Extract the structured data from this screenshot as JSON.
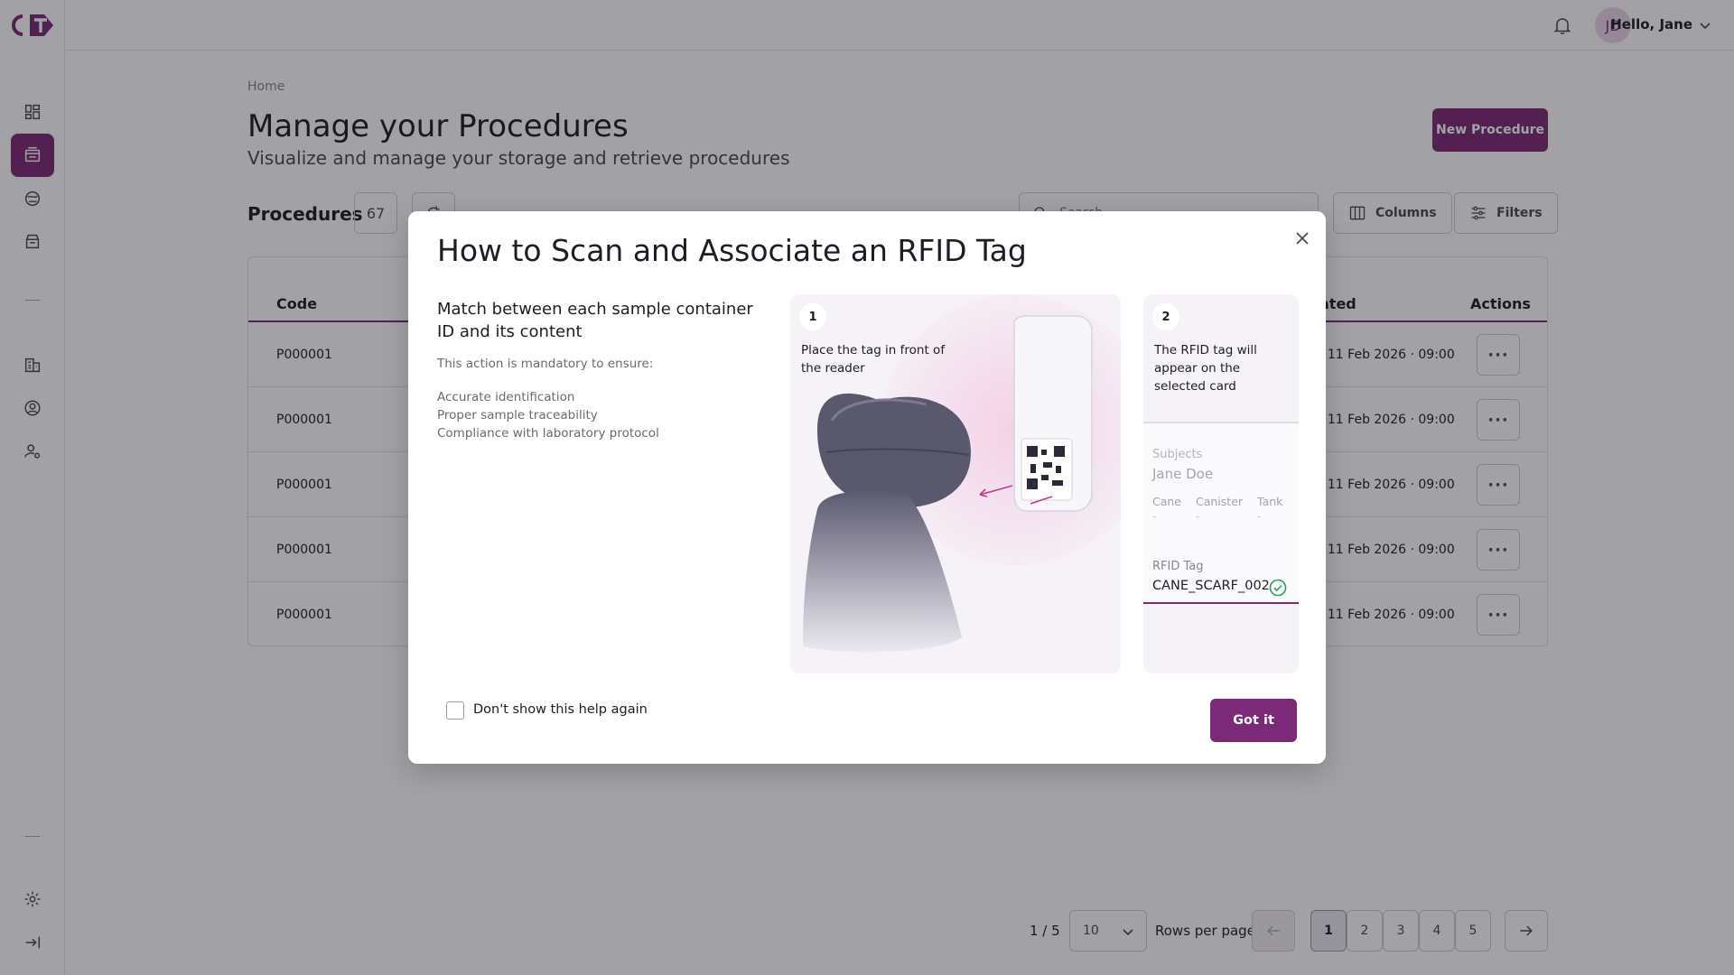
{
  "app": {
    "logo_text": "CT"
  },
  "header": {
    "avatar_initials": "JD",
    "greeting": "Hello, Jane"
  },
  "breadcrumb": "Home",
  "page": {
    "title": "Manage your Procedures",
    "subtitle": "Visualize and manage your storage and retrieve procedures",
    "new_button": "New Procedure"
  },
  "toolbar": {
    "label": "Procedures",
    "count": "67",
    "search_placeholder": "Search",
    "columns_label": "Columns",
    "filters_label": "Filters"
  },
  "table": {
    "columns": {
      "code": "Code",
      "updated": "ated",
      "actions": "Actions"
    },
    "rows": [
      {
        "code": "P000001",
        "date": ", 11 Feb 2026 · 09:00",
        "action": "···"
      },
      {
        "code": "P000001",
        "date": ", 11 Feb 2026 · 09:00",
        "action": "···"
      },
      {
        "code": "P000001",
        "date": ", 11 Feb 2026 · 09:00",
        "action": "···"
      },
      {
        "code": "P000001",
        "date": ", 11 Feb 2026 · 09:00",
        "action": "···"
      },
      {
        "code": "P000001",
        "date": ", 11 Feb 2026 · 09:00",
        "action": "···"
      }
    ]
  },
  "pagination": {
    "info": "1 / 5",
    "rows_value": "10",
    "rows_label": "Rows per page",
    "pages": [
      "1",
      "2",
      "3",
      "4",
      "5"
    ],
    "current": "1"
  },
  "modal": {
    "title": "How to Scan and Associate an RFID Tag",
    "heading": "Match between each sample container ID and its content",
    "intro": "This action is mandatory to ensure:",
    "points": [
      "Accurate identification",
      "Proper sample traceability",
      "Compliance with laboratory protocol"
    ],
    "step1": {
      "number": "1",
      "text": "Place the tag in front of the reader"
    },
    "step2": {
      "number": "2",
      "text": "The RFID tag will appear on the selected card",
      "subjects_label": "Subjects",
      "subject_name": "Jane Doe",
      "cane_label": "Cane",
      "canister_label": "Canister",
      "tank_label": "Tank",
      "dash": "-",
      "rfid_label": "RFID Tag",
      "rfid_value": "CANE_SCARF_002"
    },
    "dont_show_label": "Don't show this help again",
    "got_it": "Got it"
  },
  "colors": {
    "brand": "#7a2a76",
    "success": "#2e9e5b"
  }
}
